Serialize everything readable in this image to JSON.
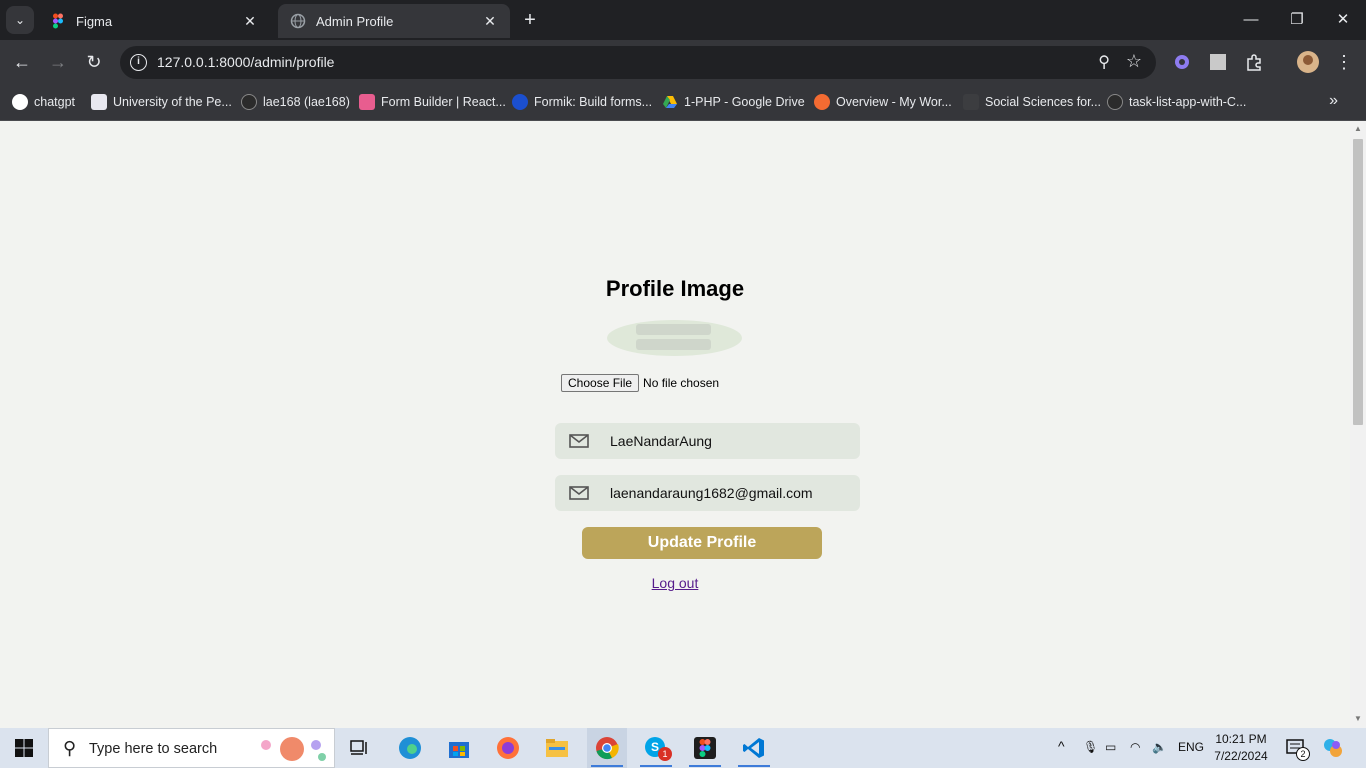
{
  "browser": {
    "tabs": [
      {
        "label": "Figma",
        "active": false
      },
      {
        "label": "Admin Profile",
        "active": true
      }
    ],
    "url": "127.0.0.1:8000/admin/profile",
    "bookmarks": [
      {
        "label": "chatgpt",
        "icon": "chatgpt-icon"
      },
      {
        "label": "University of the Pe...",
        "icon": "university-icon"
      },
      {
        "label": "lae168 (lae168)",
        "icon": "github-icon"
      },
      {
        "label": "Form Builder | React...",
        "icon": "form-builder-icon"
      },
      {
        "label": "Formik: Build forms...",
        "icon": "formik-icon"
      },
      {
        "label": "1-PHP - Google Drive",
        "icon": "google-drive-icon"
      },
      {
        "label": "Overview - My Wor...",
        "icon": "overview-icon"
      },
      {
        "label": "Social Sciences for...",
        "icon": "social-sciences-icon"
      },
      {
        "label": "task-list-app-with-C...",
        "icon": "github-icon"
      }
    ]
  },
  "page": {
    "title": "Profile Image",
    "file_input": {
      "button_label": "Choose File",
      "status": "No file chosen"
    },
    "name_field": {
      "value": "LaeNandarAung",
      "icon": "mail-icon"
    },
    "email_field": {
      "value": "laenandaraung1682@gmail.com",
      "icon": "mail-icon"
    },
    "update_button": "Update Profile",
    "logout_link": "Log out",
    "accent_color": "#bca55a",
    "field_bg": "#e1e7df"
  },
  "taskbar": {
    "search_placeholder": "Type here to search",
    "language": "ENG",
    "time": "10:21 PM",
    "date": "7/22/2024",
    "skype_badge": "1",
    "notification_count": "2"
  }
}
